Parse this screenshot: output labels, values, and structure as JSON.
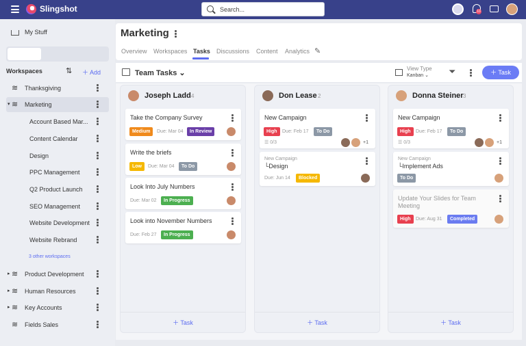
{
  "app": {
    "brand": "Slingshot",
    "search_placeholder": "Search...",
    "notif_count": "10"
  },
  "sidebar": {
    "my_stuff": "My Stuff",
    "workspaces_label": "Workspaces",
    "add_label": "Add",
    "items": [
      "Thanksgiving",
      "Marketing",
      "Account Based Mar...",
      "Content Calendar",
      "Design",
      "PPC Management",
      "Q2 Product Launch",
      "SEO Management",
      "Website Development",
      "Website Rebrand",
      "3 other workspaces",
      "Product Development",
      "Human Resources",
      "Key Accounts",
      "Fields Sales"
    ]
  },
  "page": {
    "title": "Marketing",
    "tabs": [
      "Overview",
      "Workspaces",
      "Tasks",
      "Discussions",
      "Content",
      "Analytics"
    ]
  },
  "toolbar": {
    "board_name": "Team Tasks",
    "view_type_label": "View Type",
    "view_type_value": "Kanban",
    "add_task": "Task"
  },
  "columns": [
    {
      "name": "Joseph Ladd",
      "count": "4",
      "add": "Task",
      "cards": [
        {
          "title": "Take the Company Survey",
          "priority": "Medium",
          "due": "Due: Mar 04",
          "status": "In Review"
        },
        {
          "title": "Write the briefs",
          "priority": "Low",
          "due": "Due: Mar 04",
          "status": "To Do"
        },
        {
          "title": "Look Into July Numbers",
          "due": "Due: Mar 02",
          "status": "In Progress"
        },
        {
          "title": "Look into November Numbers",
          "due": "Due: Feb 27",
          "status": "In Progress"
        }
      ]
    },
    {
      "name": "Don Lease",
      "count": "2",
      "add": "Task",
      "cards": [
        {
          "title": "New Campaign",
          "priority": "High",
          "due": "Due: Feb 17",
          "status": "To Do",
          "checklist": "0/3",
          "more": "+1"
        },
        {
          "parent": "New Campaign",
          "title": "Design",
          "due": "Due: Jun 14",
          "status": "Blocked"
        }
      ]
    },
    {
      "name": "Donna Steiner",
      "count": "3",
      "add": "Task",
      "cards": [
        {
          "title": "New Campaign",
          "priority": "High",
          "due": "Due: Feb 17",
          "status": "To Do",
          "checklist": "0/3",
          "more": "+1"
        },
        {
          "parent": "New Campaign",
          "title": "Implement Ads",
          "status": "To Do"
        },
        {
          "title": "Update Your Slides for Team Meeting",
          "priority": "High",
          "due": "Due: Aug 31",
          "status": "Completed"
        }
      ]
    }
  ],
  "colors": {
    "topbar": "#38418a",
    "accent": "#5c6cf0",
    "medium": "#f08a1c",
    "low": "#f5b800",
    "high": "#e8404f",
    "in_review": "#6a3fa8",
    "todo": "#8c98a6",
    "in_progress": "#4caf50",
    "blocked": "#f5b800",
    "completed": "#6b7cf0"
  }
}
